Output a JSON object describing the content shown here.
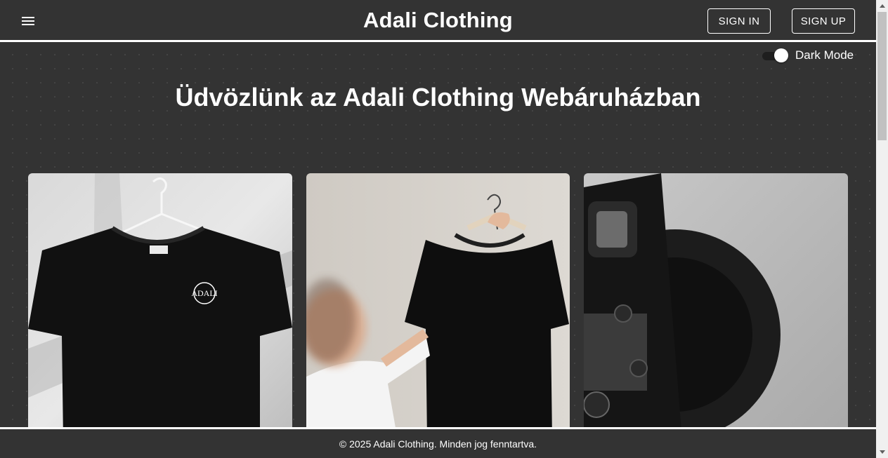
{
  "header": {
    "brand": "Adali Clothing",
    "menu_icon": "hamburger-menu-icon",
    "sign_in_label": "SIGN IN",
    "sign_up_label": "SIGN UP"
  },
  "theme_toggle": {
    "label": "Dark Mode",
    "checked": true
  },
  "hero": {
    "title": "Üdvözlünk az Adali Clothing Webáruházban"
  },
  "cards": [
    {
      "image": "black-tshirt-on-hanger-photo",
      "logo_text": "ADALI"
    },
    {
      "image": "person-holding-black-tshirt-photo"
    },
    {
      "image": "black-camera-photo"
    }
  ],
  "footer": {
    "copyright": "© 2025 Adali Clothing. Minden jog fenntartva."
  },
  "colors": {
    "background": "#333333",
    "text": "#ffffff",
    "accent_border": "#ffffff"
  }
}
